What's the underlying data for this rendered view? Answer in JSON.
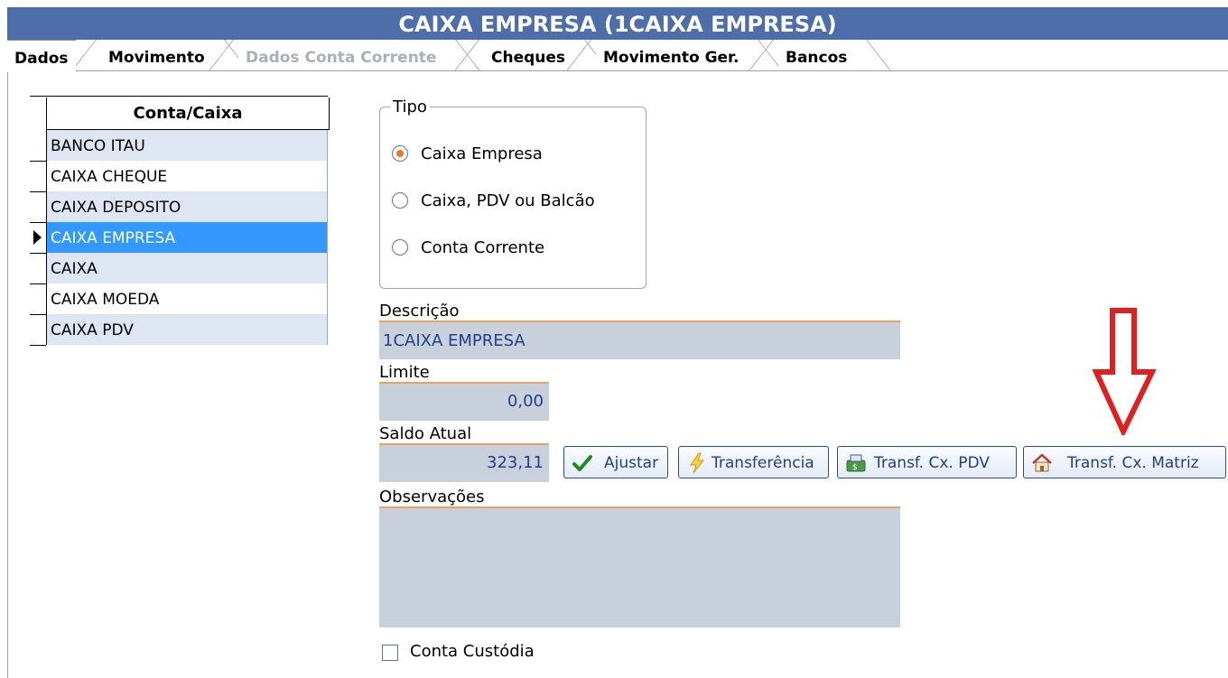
{
  "window": {
    "title": "CAIXA EMPRESA (1CAIXA EMPRESA)"
  },
  "tabs": [
    {
      "label": "Dados",
      "state": "active"
    },
    {
      "label": "Movimento",
      "state": "normal"
    },
    {
      "label": "Dados Conta Corrente",
      "state": "disabled"
    },
    {
      "label": "Cheques",
      "state": "normal"
    },
    {
      "label": "Movimento Ger.",
      "state": "normal"
    },
    {
      "label": "Bancos",
      "state": "normal"
    }
  ],
  "grid": {
    "column_header": "Conta/Caixa",
    "rows": [
      "BANCO ITAU",
      "CAIXA CHEQUE",
      "CAIXA DEPOSITO",
      "CAIXA EMPRESA",
      "CAIXA",
      "CAIXA MOEDA",
      "CAIXA PDV"
    ],
    "selected_index": 3
  },
  "tipo": {
    "legend": "Tipo",
    "options": [
      "Caixa Empresa",
      "Caixa, PDV ou Balcão",
      "Conta Corrente"
    ],
    "selected": "Caixa Empresa"
  },
  "fields": {
    "descricao_label": "Descrição",
    "descricao_value": "1CAIXA EMPRESA",
    "limite_label": "Limite",
    "limite_value": "0,00",
    "saldo_label": "Saldo Atual",
    "saldo_value": "323,11",
    "observacoes_label": "Observações",
    "observacoes_value": ""
  },
  "buttons": {
    "ajustar": "Ajustar",
    "transferencia": "Transferência",
    "transf_pdv": "Transf. Cx. PDV",
    "transf_matriz": "Transf. Cx. Matriz"
  },
  "conta_custodia": {
    "label": "Conta Custódia",
    "checked": false
  },
  "colors": {
    "title_bar": "#4d6ea8",
    "selection": "#3399ff",
    "field_bg": "#c8d1db",
    "accent_line": "#f0a060",
    "annotation": "#e02020"
  },
  "icons": [
    "checkmark-icon",
    "lightning-icon",
    "cash-register-icon",
    "house-icon",
    "red-down-arrow-annotation"
  ]
}
